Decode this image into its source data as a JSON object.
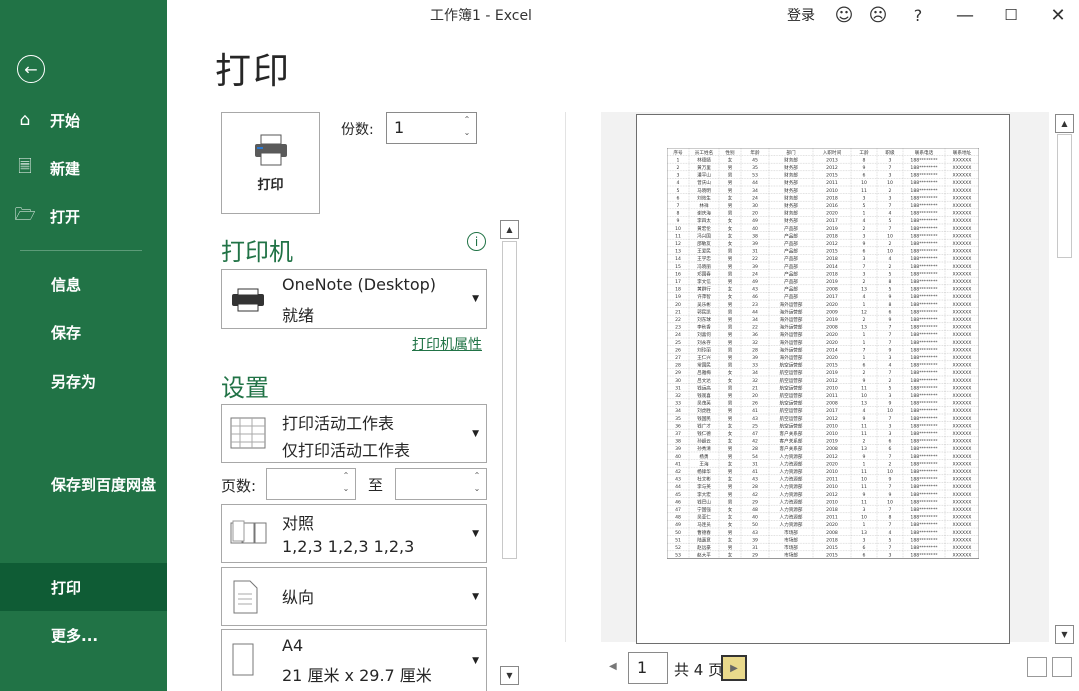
{
  "window": {
    "title": "工作簿1  -  Excel",
    "login_label": "登录",
    "help_label": "?"
  },
  "sidebar": {
    "items": [
      {
        "label": "开始"
      },
      {
        "label": "新建"
      },
      {
        "label": "打开"
      },
      {
        "label": "信息"
      },
      {
        "label": "保存"
      },
      {
        "label": "另存为"
      },
      {
        "label": "保存到百度网盘"
      },
      {
        "label": "打印"
      },
      {
        "label": "更多..."
      }
    ]
  },
  "print": {
    "page_title": "打印",
    "print_button_label": "打印",
    "copies_label": "份数:",
    "copies_value": "1"
  },
  "printer": {
    "heading": "打印机",
    "name": "OneNote (Desktop)",
    "status": "就绪",
    "properties_link": "打印机属性"
  },
  "settings": {
    "heading": "设置",
    "scope_title": "打印活动工作表",
    "scope_sub": "仅打印活动工作表",
    "pages_label": "页数:",
    "pages_from": "",
    "pages_to_label": "至",
    "pages_to": "",
    "collate_title": "对照",
    "collate_sub": "1,2,3    1,2,3    1,2,3",
    "orientation": "纵向",
    "paper_title": "A4",
    "paper_sub": "21 厘米 x 29.7 厘米"
  },
  "preview": {
    "current_page": "1",
    "total_pages_label": "共 4 页",
    "headers": [
      "序号",
      "员工姓名",
      "性别",
      "年龄",
      "部门",
      "入职时间",
      "工龄",
      "职级",
      "联系电话",
      "联系地址"
    ],
    "rows": [
      [
        "1",
        "林德婧",
        "女",
        "45",
        "财务部",
        "2013",
        "8",
        "3",
        "188********",
        "XXXXXX"
      ],
      [
        "2",
        "黄万里",
        "男",
        "35",
        "财务部",
        "2012",
        "9",
        "7",
        "188********",
        "XXXXXX"
      ],
      [
        "3",
        "潘平山",
        "男",
        "53",
        "财务部",
        "2015",
        "6",
        "3",
        "188********",
        "XXXXXX"
      ],
      [
        "4",
        "曾庆山",
        "男",
        "44",
        "财务部",
        "2011",
        "10",
        "10",
        "188********",
        "XXXXXX"
      ],
      [
        "5",
        "马晓明",
        "男",
        "34",
        "财务部",
        "2010",
        "11",
        "2",
        "188********",
        "XXXXXX"
      ],
      [
        "6",
        "刘效生",
        "女",
        "24",
        "财务部",
        "2018",
        "3",
        "3",
        "188********",
        "XXXXXX"
      ],
      [
        "7",
        "林祥",
        "男",
        "30",
        "财务部",
        "2016",
        "5",
        "7",
        "188********",
        "XXXXXX"
      ],
      [
        "8",
        "谢庆海",
        "男",
        "20",
        "财务部",
        "2020",
        "1",
        "4",
        "188********",
        "XXXXXX"
      ],
      [
        "9",
        "李四太",
        "女",
        "49",
        "财务部",
        "2017",
        "4",
        "5",
        "188********",
        "XXXXXX"
      ],
      [
        "10",
        "黄宏伦",
        "女",
        "40",
        "产品部",
        "2019",
        "2",
        "7",
        "188********",
        "XXXXXX"
      ],
      [
        "11",
        "冯兴国",
        "女",
        "38",
        "产品部",
        "2018",
        "3",
        "10",
        "188********",
        "XXXXXX"
      ],
      [
        "12",
        "邵敏友",
        "女",
        "39",
        "产品部",
        "2012",
        "9",
        "2",
        "188********",
        "XXXXXX"
      ],
      [
        "13",
        "王爱民",
        "男",
        "31",
        "产品部",
        "2015",
        "6",
        "10",
        "188********",
        "XXXXXX"
      ],
      [
        "14",
        "王学忠",
        "男",
        "22",
        "产品部",
        "2018",
        "3",
        "4",
        "188********",
        "XXXXXX"
      ],
      [
        "15",
        "冯晓丽",
        "男",
        "39",
        "产品部",
        "2014",
        "7",
        "2",
        "188********",
        "XXXXXX"
      ],
      [
        "16",
        "邓国春",
        "男",
        "24",
        "产品部",
        "2018",
        "3",
        "5",
        "188********",
        "XXXXXX"
      ],
      [
        "17",
        "李文信",
        "男",
        "49",
        "产品部",
        "2019",
        "2",
        "8",
        "188********",
        "XXXXXX"
      ],
      [
        "18",
        "黄群行",
        "女",
        "43",
        "产品部",
        "2008",
        "13",
        "5",
        "188********",
        "XXXXXX"
      ],
      [
        "19",
        "许萍智",
        "女",
        "46",
        "产品部",
        "2017",
        "4",
        "9",
        "188********",
        "XXXXXX"
      ],
      [
        "20",
        "吴乐彬",
        "男",
        "23",
        "海外运营部",
        "2020",
        "1",
        "8",
        "188********",
        "XXXXXX"
      ],
      [
        "21",
        "郭民凯",
        "男",
        "44",
        "海外运营部",
        "2009",
        "12",
        "6",
        "188********",
        "XXXXXX"
      ],
      [
        "22",
        "刘东球",
        "男",
        "34",
        "海外运营部",
        "2019",
        "2",
        "9",
        "188********",
        "XXXXXX"
      ],
      [
        "23",
        "李秋香",
        "男",
        "22",
        "海外运营部",
        "2008",
        "13",
        "7",
        "188********",
        "XXXXXX"
      ],
      [
        "24",
        "刘喜何",
        "男",
        "36",
        "海外运营部",
        "2020",
        "1",
        "7",
        "188********",
        "XXXXXX"
      ],
      [
        "25",
        "刘永存",
        "男",
        "32",
        "海外运营部",
        "2020",
        "1",
        "7",
        "188********",
        "XXXXXX"
      ],
      [
        "26",
        "刘玲丽",
        "男",
        "28",
        "海外运营部",
        "2014",
        "7",
        "9",
        "188********",
        "XXXXXX"
      ],
      [
        "27",
        "王仁兴",
        "男",
        "39",
        "海外运营部",
        "2020",
        "1",
        "3",
        "188********",
        "XXXXXX"
      ],
      [
        "28",
        "常国民",
        "男",
        "33",
        "航空运营部",
        "2015",
        "6",
        "4",
        "188********",
        "XXXXXX"
      ],
      [
        "29",
        "吕雅梅",
        "女",
        "34",
        "航空运营部",
        "2019",
        "2",
        "7",
        "188********",
        "XXXXXX"
      ],
      [
        "30",
        "吕文达",
        "女",
        "32",
        "航空运营部",
        "2012",
        "9",
        "2",
        "188********",
        "XXXXXX"
      ],
      [
        "31",
        "钱运高",
        "男",
        "21",
        "航空运营部",
        "2010",
        "11",
        "5",
        "188********",
        "XXXXXX"
      ],
      [
        "32",
        "钱观喜",
        "男",
        "20",
        "航空运营部",
        "2011",
        "10",
        "3",
        "188********",
        "XXXXXX"
      ],
      [
        "33",
        "吴茂英",
        "男",
        "26",
        "航空运营部",
        "2008",
        "13",
        "9",
        "188********",
        "XXXXXX"
      ],
      [
        "34",
        "刘虎胜",
        "男",
        "41",
        "航空运营部",
        "2017",
        "4",
        "10",
        "188********",
        "XXXXXX"
      ],
      [
        "35",
        "钱国民",
        "男",
        "43",
        "航空运营部",
        "2012",
        "9",
        "7",
        "188********",
        "XXXXXX"
      ],
      [
        "36",
        "钱广才",
        "女",
        "25",
        "航空运营部",
        "2010",
        "11",
        "3",
        "188********",
        "XXXXXX"
      ],
      [
        "37",
        "钱仁德",
        "女",
        "47",
        "客户关系部",
        "2010",
        "11",
        "3",
        "188********",
        "XXXXXX"
      ],
      [
        "38",
        "孙超云",
        "女",
        "42",
        "客户关系部",
        "2019",
        "2",
        "6",
        "188********",
        "XXXXXX"
      ],
      [
        "39",
        "孙秀清",
        "男",
        "28",
        "客户关系部",
        "2008",
        "13",
        "6",
        "188********",
        "XXXXXX"
      ],
      [
        "40",
        "杨勇",
        "男",
        "54",
        "人力资源部",
        "2012",
        "9",
        "7",
        "188********",
        "XXXXXX"
      ],
      [
        "41",
        "王海",
        "女",
        "31",
        "人力资源部",
        "2020",
        "1",
        "2",
        "188********",
        "XXXXXX"
      ],
      [
        "42",
        "杨锋华",
        "男",
        "41",
        "人力资源部",
        "2010",
        "11",
        "10",
        "188********",
        "XXXXXX"
      ],
      [
        "43",
        "杜文彬",
        "女",
        "43",
        "人力资源部",
        "2011",
        "10",
        "9",
        "188********",
        "XXXXXX"
      ],
      [
        "44",
        "李与英",
        "男",
        "28",
        "人力资源部",
        "2010",
        "11",
        "7",
        "188********",
        "XXXXXX"
      ],
      [
        "45",
        "李大宏",
        "男",
        "42",
        "人力资源部",
        "2012",
        "9",
        "9",
        "188********",
        "XXXXXX"
      ],
      [
        "46",
        "钱巴山",
        "男",
        "29",
        "人力资源部",
        "2010",
        "11",
        "10",
        "188********",
        "XXXXXX"
      ],
      [
        "47",
        "宁国强",
        "女",
        "48",
        "人力资源部",
        "2018",
        "3",
        "7",
        "188********",
        "XXXXXX"
      ],
      [
        "48",
        "吴亚仁",
        "女",
        "40",
        "人力资源部",
        "2011",
        "10",
        "8",
        "188********",
        "XXXXXX"
      ],
      [
        "49",
        "马连员",
        "女",
        "50",
        "人力资源部",
        "2020",
        "1",
        "7",
        "188********",
        "XXXXXX"
      ],
      [
        "50",
        "曹德春",
        "男",
        "43",
        "市场部",
        "2008",
        "13",
        "4",
        "188********",
        "XXXXXX"
      ],
      [
        "51",
        "陆嘉意",
        "女",
        "39",
        "市场部",
        "2018",
        "3",
        "5",
        "188********",
        "XXXXXX"
      ],
      [
        "52",
        "赵远豪",
        "男",
        "31",
        "市场部",
        "2015",
        "6",
        "7",
        "188********",
        "XXXXXX"
      ],
      [
        "53",
        "赵大平",
        "女",
        "29",
        "市场部",
        "2015",
        "6",
        "3",
        "188********",
        "XXXXXX"
      ]
    ]
  }
}
